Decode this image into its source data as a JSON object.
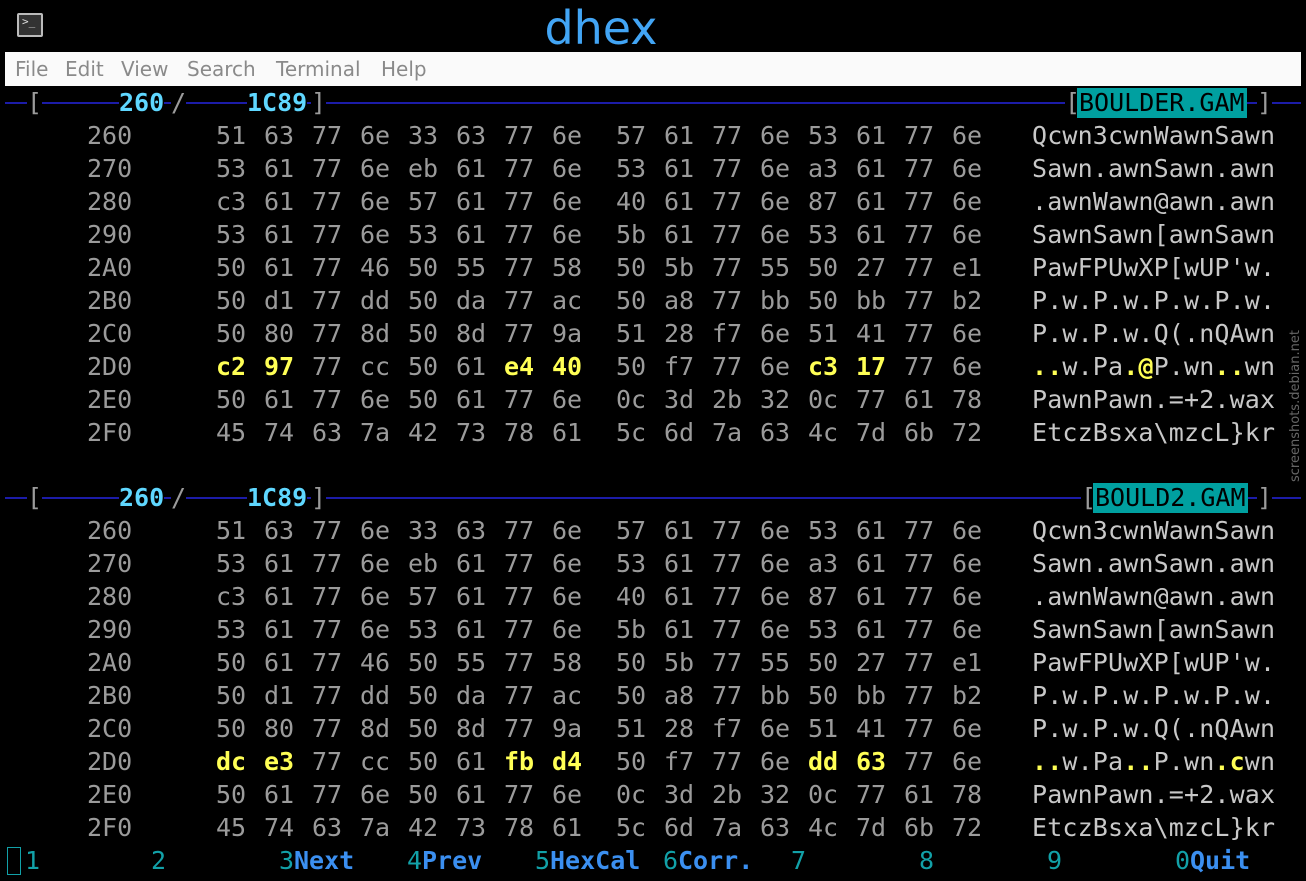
{
  "window": {
    "title": "dhex",
    "icon": "terminal-icon"
  },
  "menu": [
    "File",
    "Edit",
    "View",
    "Search",
    "Terminal",
    "Help"
  ],
  "panels": [
    {
      "cursor_pos": "260",
      "slash": "/",
      "file_size": "1C89",
      "filename": "BOULDER.GAM",
      "rows": [
        {
          "addr": "260",
          "bytes": [
            "51",
            "63",
            "77",
            "6e",
            "33",
            "63",
            "77",
            "6e",
            "57",
            "61",
            "77",
            "6e",
            "53",
            "61",
            "77",
            "6e"
          ],
          "ascii": "Qcwn3cwnWawnSawn",
          "diff": []
        },
        {
          "addr": "270",
          "bytes": [
            "53",
            "61",
            "77",
            "6e",
            "eb",
            "61",
            "77",
            "6e",
            "53",
            "61",
            "77",
            "6e",
            "a3",
            "61",
            "77",
            "6e"
          ],
          "ascii": "Sawn.awnSawn.awn",
          "diff": []
        },
        {
          "addr": "280",
          "bytes": [
            "c3",
            "61",
            "77",
            "6e",
            "57",
            "61",
            "77",
            "6e",
            "40",
            "61",
            "77",
            "6e",
            "87",
            "61",
            "77",
            "6e"
          ],
          "ascii": ".awnWawn@awn.awn",
          "diff": []
        },
        {
          "addr": "290",
          "bytes": [
            "53",
            "61",
            "77",
            "6e",
            "53",
            "61",
            "77",
            "6e",
            "5b",
            "61",
            "77",
            "6e",
            "53",
            "61",
            "77",
            "6e"
          ],
          "ascii": "SawnSawn[awnSawn",
          "diff": []
        },
        {
          "addr": "2A0",
          "bytes": [
            "50",
            "61",
            "77",
            "46",
            "50",
            "55",
            "77",
            "58",
            "50",
            "5b",
            "77",
            "55",
            "50",
            "27",
            "77",
            "e1"
          ],
          "ascii": "PawFPUwXP[wUP'w.",
          "diff": []
        },
        {
          "addr": "2B0",
          "bytes": [
            "50",
            "d1",
            "77",
            "dd",
            "50",
            "da",
            "77",
            "ac",
            "50",
            "a8",
            "77",
            "bb",
            "50",
            "bb",
            "77",
            "b2"
          ],
          "ascii": "P.w.P.w.P.w.P.w.",
          "diff": []
        },
        {
          "addr": "2C0",
          "bytes": [
            "50",
            "80",
            "77",
            "8d",
            "50",
            "8d",
            "77",
            "9a",
            "51",
            "28",
            "f7",
            "6e",
            "51",
            "41",
            "77",
            "6e"
          ],
          "ascii": "P.w.P.w.Q(.nQAwn",
          "diff": []
        },
        {
          "addr": "2D0",
          "bytes": [
            "c2",
            "97",
            "77",
            "cc",
            "50",
            "61",
            "e4",
            "40",
            "50",
            "f7",
            "77",
            "6e",
            "c3",
            "17",
            "77",
            "6e"
          ],
          "ascii": "..w.Pa.@P.wn..wn",
          "diff": [
            0,
            1,
            6,
            7,
            12,
            13
          ]
        },
        {
          "addr": "2E0",
          "bytes": [
            "50",
            "61",
            "77",
            "6e",
            "50",
            "61",
            "77",
            "6e",
            "0c",
            "3d",
            "2b",
            "32",
            "0c",
            "77",
            "61",
            "78"
          ],
          "ascii": "PawnPawn.=+2.wax",
          "diff": []
        },
        {
          "addr": "2F0",
          "bytes": [
            "45",
            "74",
            "63",
            "7a",
            "42",
            "73",
            "78",
            "61",
            "5c",
            "6d",
            "7a",
            "63",
            "4c",
            "7d",
            "6b",
            "72"
          ],
          "ascii": "EtczBsxa\\mzcL}kr",
          "diff": []
        }
      ]
    },
    {
      "cursor_pos": "260",
      "slash": "/",
      "file_size": "1C89",
      "filename": "BOULD2.GAM",
      "rows": [
        {
          "addr": "260",
          "bytes": [
            "51",
            "63",
            "77",
            "6e",
            "33",
            "63",
            "77",
            "6e",
            "57",
            "61",
            "77",
            "6e",
            "53",
            "61",
            "77",
            "6e"
          ],
          "ascii": "Qcwn3cwnWawnSawn",
          "diff": []
        },
        {
          "addr": "270",
          "bytes": [
            "53",
            "61",
            "77",
            "6e",
            "eb",
            "61",
            "77",
            "6e",
            "53",
            "61",
            "77",
            "6e",
            "a3",
            "61",
            "77",
            "6e"
          ],
          "ascii": "Sawn.awnSawn.awn",
          "diff": []
        },
        {
          "addr": "280",
          "bytes": [
            "c3",
            "61",
            "77",
            "6e",
            "57",
            "61",
            "77",
            "6e",
            "40",
            "61",
            "77",
            "6e",
            "87",
            "61",
            "77",
            "6e"
          ],
          "ascii": ".awnWawn@awn.awn",
          "diff": []
        },
        {
          "addr": "290",
          "bytes": [
            "53",
            "61",
            "77",
            "6e",
            "53",
            "61",
            "77",
            "6e",
            "5b",
            "61",
            "77",
            "6e",
            "53",
            "61",
            "77",
            "6e"
          ],
          "ascii": "SawnSawn[awnSawn",
          "diff": []
        },
        {
          "addr": "2A0",
          "bytes": [
            "50",
            "61",
            "77",
            "46",
            "50",
            "55",
            "77",
            "58",
            "50",
            "5b",
            "77",
            "55",
            "50",
            "27",
            "77",
            "e1"
          ],
          "ascii": "PawFPUwXP[wUP'w.",
          "diff": []
        },
        {
          "addr": "2B0",
          "bytes": [
            "50",
            "d1",
            "77",
            "dd",
            "50",
            "da",
            "77",
            "ac",
            "50",
            "a8",
            "77",
            "bb",
            "50",
            "bb",
            "77",
            "b2"
          ],
          "ascii": "P.w.P.w.P.w.P.w.",
          "diff": []
        },
        {
          "addr": "2C0",
          "bytes": [
            "50",
            "80",
            "77",
            "8d",
            "50",
            "8d",
            "77",
            "9a",
            "51",
            "28",
            "f7",
            "6e",
            "51",
            "41",
            "77",
            "6e"
          ],
          "ascii": "P.w.P.w.Q(.nQAwn",
          "diff": []
        },
        {
          "addr": "2D0",
          "bytes": [
            "dc",
            "e3",
            "77",
            "cc",
            "50",
            "61",
            "fb",
            "d4",
            "50",
            "f7",
            "77",
            "6e",
            "dd",
            "63",
            "77",
            "6e"
          ],
          "ascii": "..w.Pa..P.wn.cwn",
          "diff": [
            0,
            1,
            6,
            7,
            12,
            13
          ]
        },
        {
          "addr": "2E0",
          "bytes": [
            "50",
            "61",
            "77",
            "6e",
            "50",
            "61",
            "77",
            "6e",
            "0c",
            "3d",
            "2b",
            "32",
            "0c",
            "77",
            "61",
            "78"
          ],
          "ascii": "PawnPawn.=+2.wax",
          "diff": []
        },
        {
          "addr": "2F0",
          "bytes": [
            "45",
            "74",
            "63",
            "7a",
            "42",
            "73",
            "78",
            "61",
            "5c",
            "6d",
            "7a",
            "63",
            "4c",
            "7d",
            "6b",
            "72"
          ],
          "ascii": "EtczBsxa\\mzcL}kr",
          "diff": []
        }
      ]
    }
  ],
  "fkeys": [
    {
      "num": "1",
      "label": ""
    },
    {
      "num": "2",
      "label": ""
    },
    {
      "num": "3",
      "label": "Next"
    },
    {
      "num": "4",
      "label": "Prev"
    },
    {
      "num": "5",
      "label": "HexCal"
    },
    {
      "num": "6",
      "label": "Corr."
    },
    {
      "num": "7",
      "label": ""
    },
    {
      "num": "8",
      "label": ""
    },
    {
      "num": "9",
      "label": ""
    },
    {
      "num": "0",
      "label": "Quit"
    }
  ],
  "watermark": "screenshots.debian.net"
}
